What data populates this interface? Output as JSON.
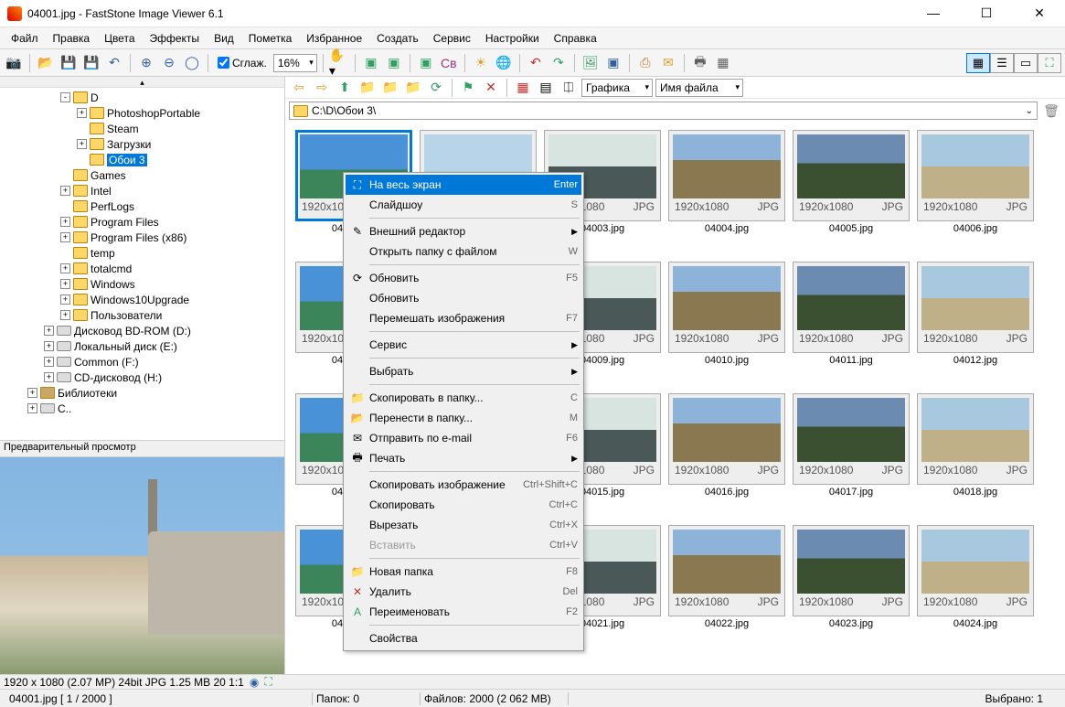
{
  "window": {
    "title": "04001.jpg  -  FastStone Image Viewer 6.1"
  },
  "menubar": [
    "Файл",
    "Правка",
    "Цвета",
    "Эффекты",
    "Вид",
    "Пометка",
    "Избранное",
    "Создать",
    "Сервис",
    "Настройки",
    "Справка"
  ],
  "toolbar": {
    "smooth": "Сглаж.",
    "zoom": "16%"
  },
  "navbar": {
    "combo1": "Графика",
    "combo2": "Имя файла"
  },
  "path": "C:\\D\\Обои 3\\",
  "tree": [
    {
      "indent": 2,
      "exp": "-",
      "label": "D"
    },
    {
      "indent": 3,
      "exp": "+",
      "label": "PhotoshopPortable"
    },
    {
      "indent": 3,
      "exp": "",
      "label": "Steam"
    },
    {
      "indent": 3,
      "exp": "+",
      "label": "Загрузки"
    },
    {
      "indent": 3,
      "exp": "",
      "label": "Обои 3",
      "selected": true
    },
    {
      "indent": 2,
      "exp": "",
      "label": "Games"
    },
    {
      "indent": 2,
      "exp": "+",
      "label": "Intel"
    },
    {
      "indent": 2,
      "exp": "",
      "label": "PerfLogs"
    },
    {
      "indent": 2,
      "exp": "+",
      "label": "Program Files"
    },
    {
      "indent": 2,
      "exp": "+",
      "label": "Program Files (x86)"
    },
    {
      "indent": 2,
      "exp": "",
      "label": "temp"
    },
    {
      "indent": 2,
      "exp": "+",
      "label": "totalcmd"
    },
    {
      "indent": 2,
      "exp": "+",
      "label": "Windows"
    },
    {
      "indent": 2,
      "exp": "+",
      "label": "Windows10Upgrade"
    },
    {
      "indent": 2,
      "exp": "+",
      "label": "Пользователи"
    },
    {
      "indent": 1,
      "exp": "+",
      "label": "Дисковод BD-ROM (D:)",
      "drive": true
    },
    {
      "indent": 1,
      "exp": "+",
      "label": "Локальный диск (E:)",
      "drive": true
    },
    {
      "indent": 1,
      "exp": "+",
      "label": "Common (F:)",
      "drive": true
    },
    {
      "indent": 1,
      "exp": "+",
      "label": "CD-дисковод (H:)",
      "drive": true
    },
    {
      "indent": 0,
      "exp": "+",
      "label": "Библиотеки",
      "lib": true
    }
  ],
  "preview_header": "Предварительный просмотр",
  "thumbs_start": 1,
  "thumb_count": 24,
  "thumb_info": {
    "res": "1920x1080",
    "type": "JPG"
  },
  "thumb_file_prefix": "04",
  "thumb_file_ext": ".jpg",
  "infobar": "1920 x 1080 (2.07 MP)   24bit   JPG   1.25 MB   20   1:1",
  "statusbar": {
    "current": "04001.jpg   [ 1 / 2000 ]",
    "folders": "Папок: 0",
    "files": "Файлов: 2000 (2 062 MB)",
    "selected": "Выбрано: 1"
  },
  "context_menu": [
    {
      "icon": "⛶",
      "label": "На весь экран",
      "shortcut": "Enter",
      "hi": true
    },
    {
      "icon": "",
      "label": "Слайдшоу",
      "shortcut": "S"
    },
    {
      "sep": true
    },
    {
      "icon": "✎",
      "label": "Внешний редактор",
      "sub": true
    },
    {
      "icon": "",
      "label": "Открыть папку с файлом",
      "shortcut": "W"
    },
    {
      "sep": true
    },
    {
      "icon": "⟳",
      "label": "Обновить",
      "shortcut": "F5"
    },
    {
      "icon": "",
      "label": "Обновить"
    },
    {
      "icon": "",
      "label": "Перемешать изображения",
      "shortcut": "F7"
    },
    {
      "sep": true
    },
    {
      "icon": "",
      "label": "Сервис",
      "sub": true
    },
    {
      "sep": true
    },
    {
      "icon": "",
      "label": "Выбрать",
      "sub": true
    },
    {
      "sep": true
    },
    {
      "icon": "📁",
      "label": "Скопировать в папку...",
      "shortcut": "C"
    },
    {
      "icon": "📂",
      "label": "Перенести в папку...",
      "shortcut": "M"
    },
    {
      "icon": "✉",
      "label": "Отправить по e-mail",
      "shortcut": "F6"
    },
    {
      "icon": "🖶",
      "label": "Печать",
      "sub": true
    },
    {
      "sep": true
    },
    {
      "icon": "",
      "label": "Скопировать изображение",
      "shortcut": "Ctrl+Shift+C"
    },
    {
      "icon": "",
      "label": "Скопировать",
      "shortcut": "Ctrl+C"
    },
    {
      "icon": "",
      "label": "Вырезать",
      "shortcut": "Ctrl+X"
    },
    {
      "icon": "",
      "label": "Вставить",
      "shortcut": "Ctrl+V",
      "disabled": true
    },
    {
      "sep": true
    },
    {
      "icon": "📁",
      "label": "Новая папка",
      "shortcut": "F8"
    },
    {
      "icon": "✕",
      "label": "Удалить",
      "shortcut": "Del",
      "red": true
    },
    {
      "icon": "A",
      "label": "Переименовать",
      "shortcut": "F2",
      "green": true
    },
    {
      "sep": true
    },
    {
      "icon": "",
      "label": "Свойства"
    }
  ],
  "palettes": [
    "linear-gradient(to bottom,#4a92d8 55%,#3c8459 55%)",
    "linear-gradient(to bottom,#b8d4e8 60%,#3a5a75 60%)",
    "linear-gradient(to bottom,#d8e4e0 50%,#4a5858 50%)",
    "linear-gradient(to bottom,#8db4d8 40%,#8a7850 40%)",
    "linear-gradient(to bottom,#6b8cb0 45%,#3a5030 45%)",
    "linear-gradient(to bottom,#a8c8e0 50%,#c0b088 50%)"
  ]
}
